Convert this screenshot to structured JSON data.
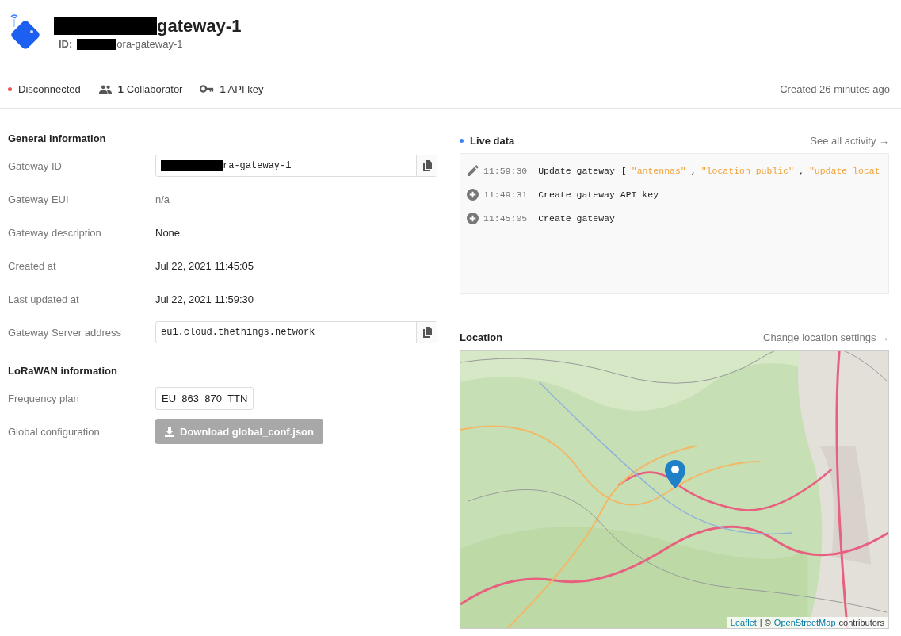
{
  "header": {
    "title": "gateway-1",
    "title_redacted": true,
    "id_label": "ID:",
    "id_value": "ora-gateway-1",
    "id_redacted": true
  },
  "stats": {
    "status": {
      "label": "Disconnected",
      "connected": false
    },
    "collaborators": {
      "count": "1",
      "label": "Collaborator"
    },
    "api_keys": {
      "count": "1",
      "label": "API key"
    },
    "created": "Created 26 minutes ago"
  },
  "general": {
    "title": "General information",
    "rows": [
      {
        "label": "Gateway ID",
        "kind": "copy",
        "value": "ra-gateway-1",
        "redacted": true
      },
      {
        "label": "Gateway EUI",
        "kind": "muted",
        "value": "n/a"
      },
      {
        "label": "Gateway description",
        "kind": "text",
        "value": "None"
      },
      {
        "label": "Created at",
        "kind": "text",
        "value": "Jul 22, 2021 11:45:05"
      },
      {
        "label": "Last updated at",
        "kind": "text",
        "value": "Jul 22, 2021 11:59:30"
      },
      {
        "label": "Gateway Server address",
        "kind": "copy",
        "value": "eu1.cloud.thethings.network"
      }
    ]
  },
  "lorawan": {
    "title": "LoRaWAN information",
    "frequency_label": "Frequency plan",
    "frequency_value": "EU_863_870_TTN",
    "config_label": "Global configuration",
    "download_button": "Download global_conf.json"
  },
  "live": {
    "title": "Live data",
    "link": "See all activity →",
    "events": [
      {
        "kind": "edit",
        "time": "11:59:30",
        "message": "Update gateway",
        "details": [
          {
            "kind": "punct",
            "text": "["
          },
          {
            "kind": "string",
            "text": "\"antennas\""
          },
          {
            "kind": "punct",
            "text": ","
          },
          {
            "kind": "string",
            "text": "\"location_public\""
          },
          {
            "kind": "punct",
            "text": ","
          },
          {
            "kind": "string",
            "text": "\"update_locat"
          }
        ]
      },
      {
        "kind": "create",
        "time": "11:49:31",
        "message": "Create gateway API key"
      },
      {
        "kind": "create",
        "time": "11:45:05",
        "message": "Create gateway"
      }
    ]
  },
  "location": {
    "title": "Location",
    "link": "Change location settings →",
    "map": {
      "kind": "picture",
      "attribution": [
        {
          "kind": "link",
          "text": "Leaflet"
        },
        {
          "kind": "text",
          "text": "| ©"
        },
        {
          "kind": "link",
          "text": "OpenStreetMap"
        },
        {
          "kind": "text",
          "text": "contributors"
        }
      ]
    }
  }
}
